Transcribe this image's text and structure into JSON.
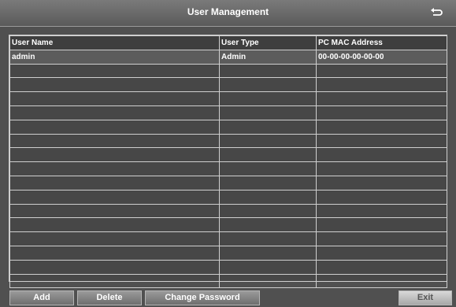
{
  "window": {
    "title": "User Management",
    "back_icon": "return-arrow-icon"
  },
  "table": {
    "headers": [
      "User Name",
      "User Type",
      "PC MAC Address"
    ],
    "rows": [
      [
        "admin",
        "Admin",
        "00-00-00-00-00-00"
      ]
    ]
  },
  "buttons": {
    "add": "Add",
    "delete": "Delete",
    "change_password": "Change Password",
    "exit": "Exit"
  }
}
